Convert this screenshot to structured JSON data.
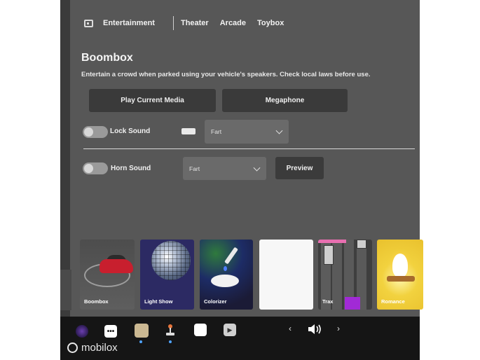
{
  "nav": {
    "icon": "entertainment-icon",
    "section": "Entertainment",
    "tabs": [
      "Theater",
      "Arcade",
      "Toybox"
    ]
  },
  "page": {
    "title": "Boombox",
    "subtitle": "Entertain a crowd when parked using your vehicle's speakers. Check local laws before use."
  },
  "buttons": {
    "play_current_media": "Play Current Media",
    "megaphone": "Megaphone",
    "preview": "Preview"
  },
  "lock_sound": {
    "label": "Lock Sound",
    "enabled": false,
    "selected": "Fart"
  },
  "horn_sound": {
    "label": "Horn Sound",
    "enabled": false,
    "selected": "Fart"
  },
  "cards": [
    {
      "label": "Boombox"
    },
    {
      "label": "Light Show"
    },
    {
      "label": "Colorizer"
    },
    {
      "label": ""
    },
    {
      "label": "Trax"
    },
    {
      "label": "Romance"
    }
  ],
  "dock": {
    "icons": [
      "camera-icon",
      "more-icon",
      "toybox-icon",
      "joystick-icon",
      "calendar-icon",
      "media-icon"
    ],
    "volume_icon": "volume-icon"
  },
  "watermark": "mobilox",
  "colors": {
    "screen_bg": "#575757",
    "button_bg": "#3a3a3a",
    "accent": "#4fa3ff",
    "trax_accent": "#a12ad6",
    "trax_pink": "#e86fb0"
  }
}
